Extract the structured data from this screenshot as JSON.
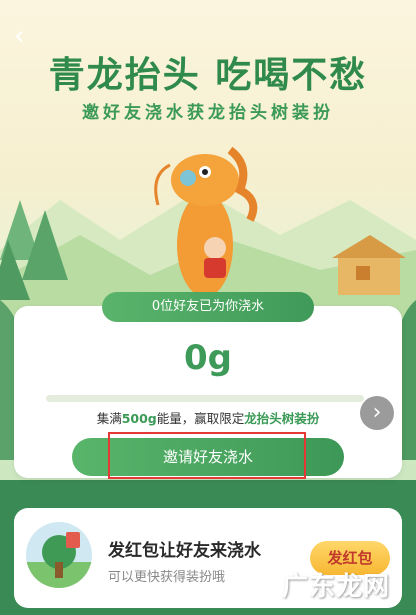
{
  "header": {
    "back_icon": "chevron-left-icon",
    "title": "青龙抬头  吃喝不愁",
    "subtitle": "邀好友浇水获龙抬头树装扮"
  },
  "progress_card": {
    "friends_watered_label": "0位好友已为你浇水",
    "amount": "0g",
    "progress_fraction": 0,
    "desc_prefix": "集满",
    "desc_amount": "500g",
    "desc_middle": "能量，赢取限定",
    "desc_reward": "龙抬头树装扮",
    "next_icon": "chevron-right-icon",
    "invite_button": "邀请好友浇水"
  },
  "red_packet_card": {
    "title": "发红包让好友来浇水",
    "subtitle": "可以更快获得装扮哦",
    "button": "发红包"
  },
  "watermark": "广东龙网",
  "colors": {
    "brand_green": "#3d9a58",
    "highlight_red": "#e53935",
    "red_packet_yellow": "#f7b733"
  }
}
